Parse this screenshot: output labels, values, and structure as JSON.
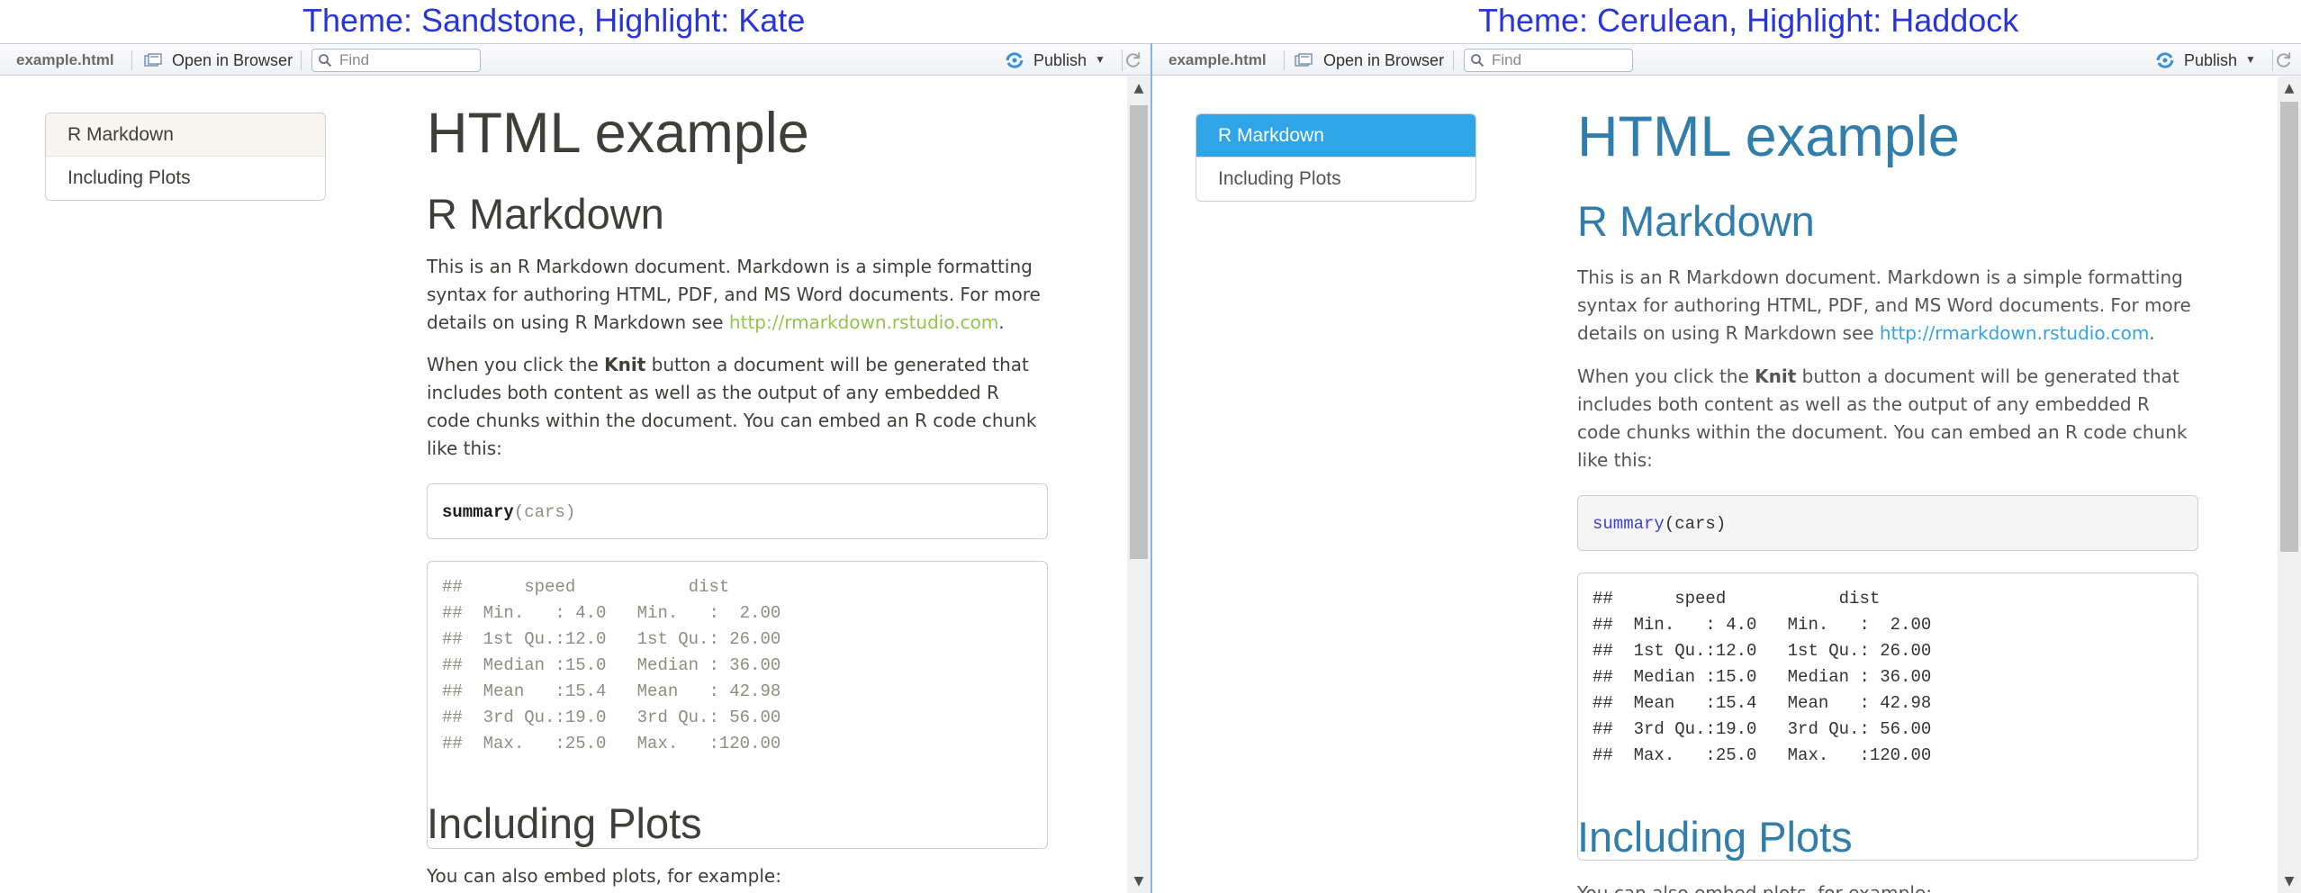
{
  "panes": [
    {
      "theme_title": "Theme: Sandstone, Highlight: Kate",
      "toolbar": {
        "file_name": "example.html",
        "open_in_browser_label": "Open in Browser",
        "find_placeholder": "Find",
        "publish_label": "Publish"
      },
      "toc": [
        {
          "label": "R Markdown",
          "active": true
        },
        {
          "label": "Including Plots",
          "active": false
        }
      ],
      "doc": {
        "title": "HTML example",
        "section1_heading": "R Markdown",
        "para1_text": "This is an R Markdown document. Markdown is a simple formatting syntax for authoring HTML, PDF, and MS Word documents. For more details on using R Markdown see ",
        "para1_link": "http://rmarkdown.rstudio.com",
        "para1_end": ".",
        "para2_before": "When you click the ",
        "para2_bold": "Knit",
        "para2_after": " button a document will be generated that includes both content as well as the output of any embedded R code chunks within the document. You can embed an R code chunk like this:",
        "code_fn": "summary",
        "code_args": "(cars)",
        "output_lines": [
          "##      speed           dist       ",
          "##  Min.   : 4.0   Min.   :  2.00  ",
          "##  1st Qu.:12.0   1st Qu.: 26.00  ",
          "##  Median :15.0   Median : 36.00  ",
          "##  Mean   :15.4   Mean   : 42.98  ",
          "##  3rd Qu.:19.0   3rd Qu.: 56.00  ",
          "##  Max.   :25.0   Max.   :120.00  "
        ],
        "section2_heading": "Including Plots",
        "para3_text": "You can also embed plots, for example:"
      },
      "colors": {
        "accent": "#93c54b",
        "text": "#3e3f3a",
        "code_fn": "#1f1c1b"
      }
    },
    {
      "theme_title": "Theme: Cerulean, Highlight: Haddock",
      "toolbar": {
        "file_name": "example.html",
        "open_in_browser_label": "Open in Browser",
        "find_placeholder": "Find",
        "publish_label": "Publish"
      },
      "toc": [
        {
          "label": "R Markdown",
          "active": true
        },
        {
          "label": "Including Plots",
          "active": false
        }
      ],
      "doc": {
        "title": "HTML example",
        "section1_heading": "R Markdown",
        "para1_text": "This is an R Markdown document. Markdown is a simple formatting syntax for authoring HTML, PDF, and MS Word documents. For more details on using R Markdown see ",
        "para1_link": "http://rmarkdown.rstudio.com",
        "para1_end": ".",
        "para2_before": "When you click the ",
        "para2_bold": "Knit",
        "para2_after": " button a document will be generated that includes both content as well as the output of any embedded R code chunks within the document. You can embed an R code chunk like this:",
        "code_fn": "summary",
        "code_args": "(cars)",
        "output_lines": [
          "##      speed           dist       ",
          "##  Min.   : 4.0   Min.   :  2.00  ",
          "##  1st Qu.:12.0   1st Qu.: 26.00  ",
          "##  Median :15.0   Median : 36.00  ",
          "##  Mean   :15.4   Mean   : 42.98  ",
          "##  3rd Qu.:19.0   3rd Qu.: 56.00  ",
          "##  Max.   :25.0   Max.   :120.00  "
        ],
        "section2_heading": "Including Plots",
        "para3_text": "You can also embed plots, for example:"
      },
      "colors": {
        "accent": "#2fa4e7",
        "text": "#317eac",
        "code_fn": "#4040d0"
      }
    }
  ],
  "icons": {
    "open_in_browser": "open-in-browser-icon",
    "find": "search-icon",
    "publish": "publish-icon",
    "refresh": "refresh-icon",
    "scroll_up": "scroll-up-arrow-icon",
    "scroll_down": "scroll-down-arrow-icon"
  }
}
